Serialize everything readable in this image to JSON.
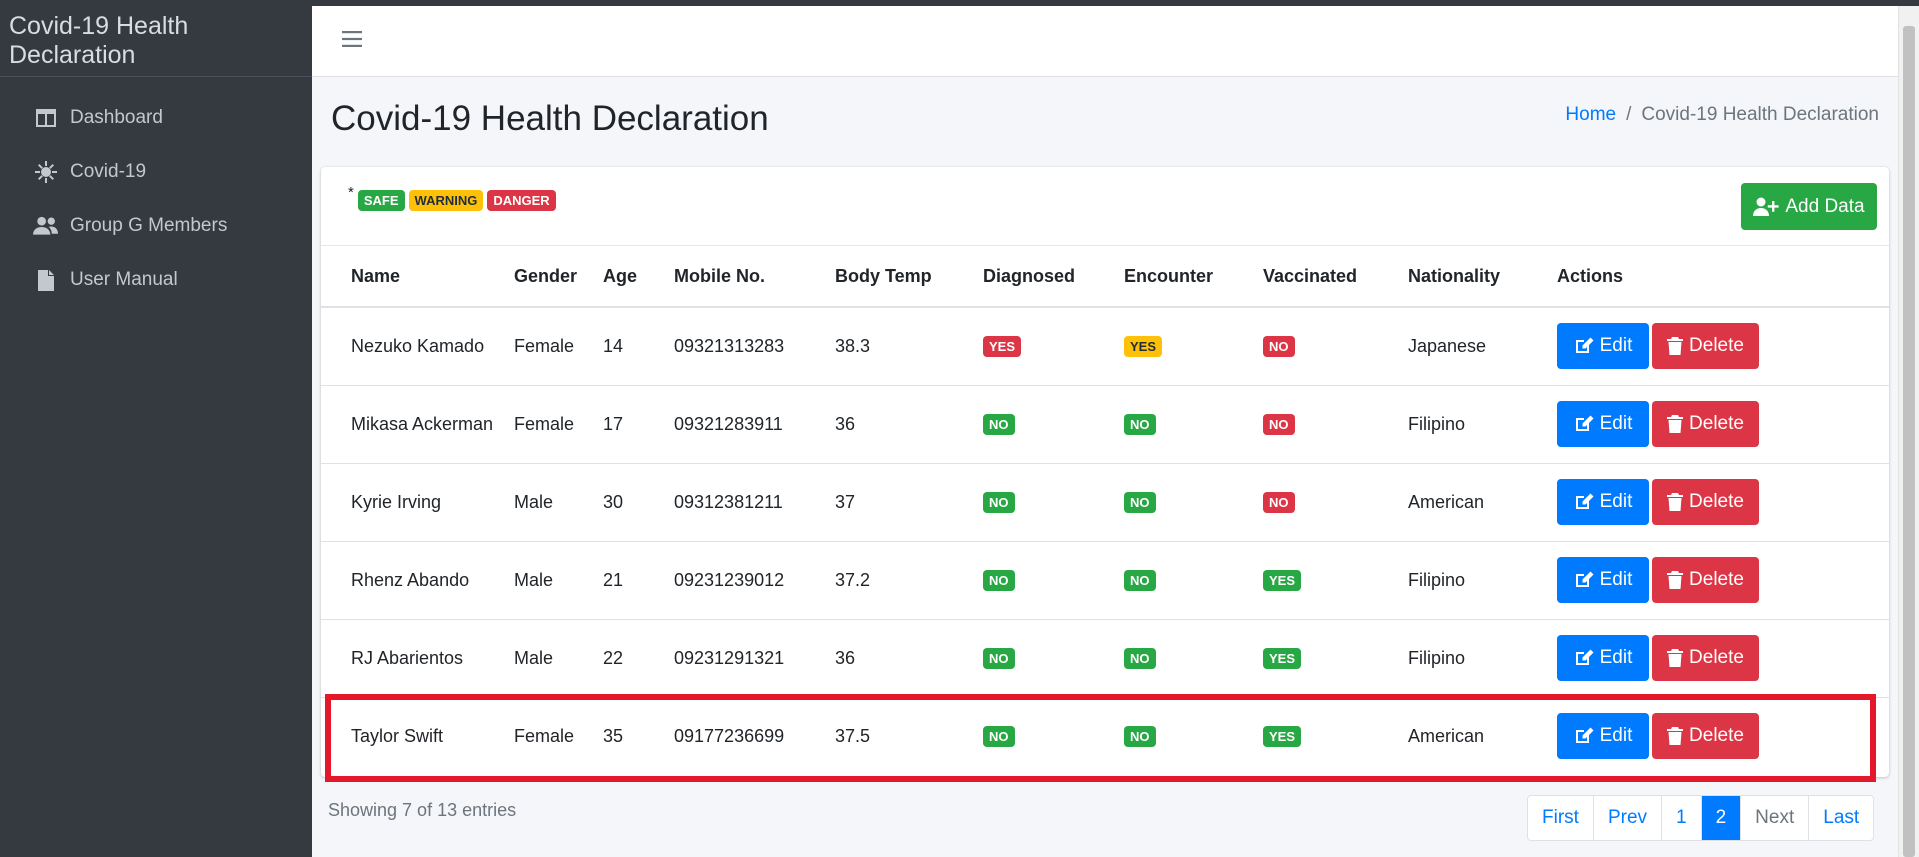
{
  "brand": "Covid-19 Health Declaration",
  "sidebar": {
    "items": [
      {
        "label": "Dashboard",
        "icon": "columns-icon"
      },
      {
        "label": "Covid-19",
        "icon": "virus-icon"
      },
      {
        "label": "Group G Members",
        "icon": "users-icon"
      },
      {
        "label": "User Manual",
        "icon": "file-icon"
      }
    ]
  },
  "header": {
    "title": "Covid-19 Health Declaration",
    "breadcrumb_home": "Home",
    "breadcrumb_sep": "/",
    "breadcrumb_current": "Covid-19 Health Declaration"
  },
  "legend": {
    "star": "*",
    "safe": "SAFE",
    "warning": "WARNING",
    "danger": "DANGER"
  },
  "toolbar": {
    "add_label": "Add Data"
  },
  "table": {
    "headers": [
      "Name",
      "Gender",
      "Age",
      "Mobile No.",
      "Body Temp",
      "Diagnosed",
      "Encounter",
      "Vaccinated",
      "Nationality",
      "Actions"
    ],
    "rows": [
      {
        "name": "Nezuko Kamado",
        "gender": "Female",
        "age": "14",
        "mobile": "09321313283",
        "temp": "38.3",
        "diagnosed": "YES",
        "encounter": "YES",
        "vaccinated": "NO",
        "nationality": "Japanese"
      },
      {
        "name": "Mikasa Ackerman",
        "gender": "Female",
        "age": "17",
        "mobile": "09321283911",
        "temp": "36",
        "diagnosed": "NO",
        "encounter": "NO",
        "vaccinated": "NO",
        "nationality": "Filipino"
      },
      {
        "name": "Kyrie Irving",
        "gender": "Male",
        "age": "30",
        "mobile": "09312381211",
        "temp": "37",
        "diagnosed": "NO",
        "encounter": "NO",
        "vaccinated": "NO",
        "nationality": "American"
      },
      {
        "name": "Rhenz Abando",
        "gender": "Male",
        "age": "21",
        "mobile": "09231239012",
        "temp": "37.2",
        "diagnosed": "NO",
        "encounter": "NO",
        "vaccinated": "YES",
        "nationality": "Filipino"
      },
      {
        "name": "RJ Abarientos",
        "gender": "Male",
        "age": "22",
        "mobile": "09231291321",
        "temp": "36",
        "diagnosed": "NO",
        "encounter": "NO",
        "vaccinated": "YES",
        "nationality": "Filipino"
      },
      {
        "name": "Taylor Swift",
        "gender": "Female",
        "age": "35",
        "mobile": "09177236699",
        "temp": "37.5",
        "diagnosed": "NO",
        "encounter": "NO",
        "vaccinated": "YES",
        "nationality": "American"
      }
    ],
    "edit_label": "Edit",
    "delete_label": "Delete"
  },
  "footer": {
    "info": "Showing 7 of 13 entries",
    "pager": {
      "first": "First",
      "prev": "Prev",
      "p1": "1",
      "p2": "2",
      "next": "Next",
      "last": "Last"
    }
  },
  "colors": {
    "success": "#28a745",
    "warning": "#ffc107",
    "danger": "#dc3545",
    "primary": "#007bff",
    "sidebar": "#343a40"
  }
}
